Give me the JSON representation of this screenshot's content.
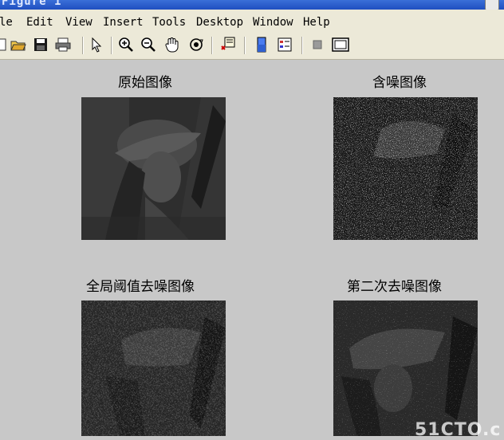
{
  "window": {
    "title": "Figure 1"
  },
  "menu": [
    "le",
    "Edit",
    "View",
    "Insert",
    "Tools",
    "Desktop",
    "Window",
    "Help"
  ],
  "toolbar": {
    "icons": [
      "new-file-icon",
      "open-folder-icon",
      "save-icon",
      "print-icon",
      "pointer-icon",
      "zoom-in-icon",
      "zoom-out-icon",
      "pan-hand-icon",
      "rotate-3d-icon",
      "data-cursor-icon",
      "colorbar-icon",
      "legend-icon",
      "hide-plot-tools-icon",
      "show-plot-tools-icon"
    ]
  },
  "figure": {
    "subplots": [
      {
        "title": "原始图像"
      },
      {
        "title": "含噪图像"
      },
      {
        "title": "全局阈值去噪图像"
      },
      {
        "title": "第二次去噪图像"
      }
    ]
  },
  "watermark": "51CTO.c"
}
